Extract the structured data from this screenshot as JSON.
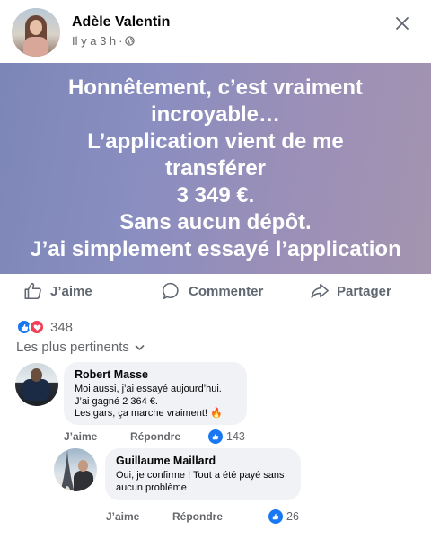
{
  "post": {
    "author": "Adèle Valentin",
    "time": "Il y a 3 h",
    "separator": "·",
    "text_lines": [
      "Honnêtement, c’est vraiment",
      "incroyable…",
      "L’application vient de me",
      "transférer",
      "3 349 €.",
      "Sans aucun dépôt.",
      "J’ai simplement essayé l’application"
    ],
    "banner_gradient": [
      "#7d86b8",
      "#a494b0"
    ]
  },
  "actions": {
    "like": "J’aime",
    "comment": "Commenter",
    "share": "Partager"
  },
  "reactions": {
    "count": "348",
    "icons": [
      "like-icon",
      "love-icon"
    ]
  },
  "sort": {
    "label": "Les plus pertinents"
  },
  "comments": [
    {
      "author": "Robert Masse",
      "text": "Moi aussi, j’ai essayé aujourd’hui.\n J’ai gagné 2 364 €.\n Les gars, ça marche vraiment! 🔥",
      "like_label": "J’aime",
      "reply_label": "Répondre",
      "likes": "143"
    },
    {
      "author": "Guillaume Maillard",
      "text": "Oui, je confirme ! Tout a été payé sans\naucun problème",
      "like_label": "J’aime",
      "reply_label": "Répondre",
      "likes": "26"
    }
  ],
  "colors": {
    "accent": "#1877f2",
    "love": "#f33e58",
    "muted": "#65676b",
    "bubble": "#f0f2f5"
  }
}
